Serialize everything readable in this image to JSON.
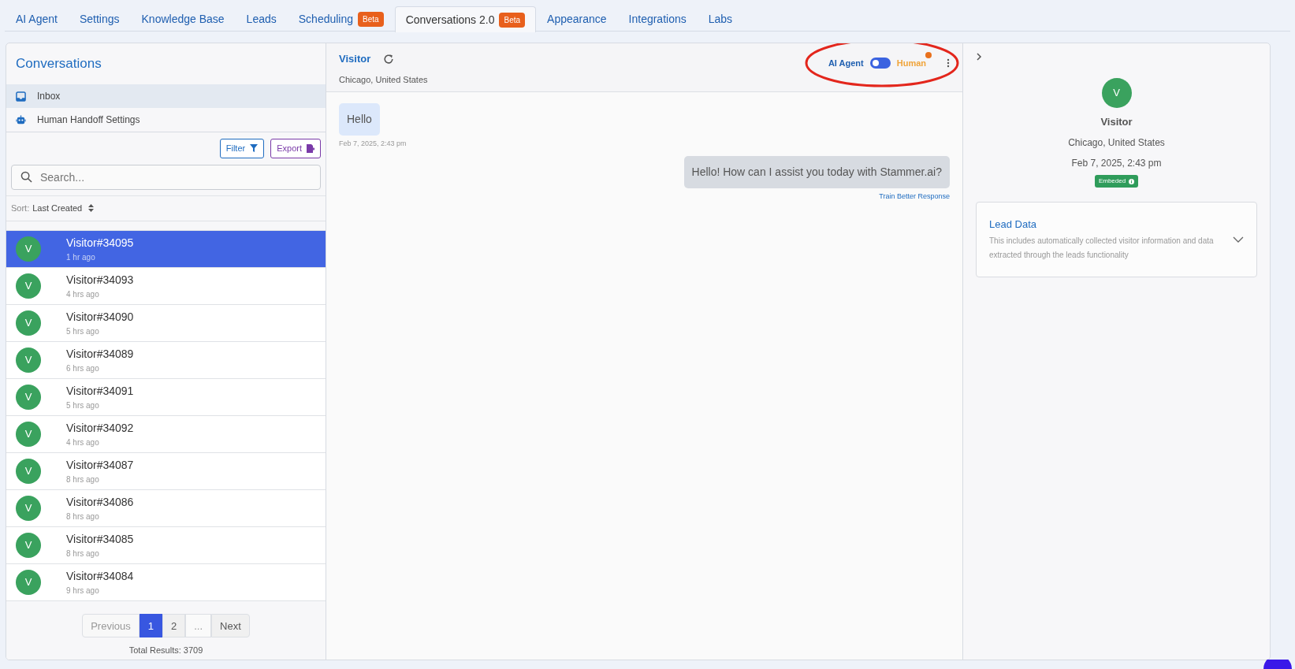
{
  "tabs": [
    {
      "label": "AI Agent",
      "selected": false
    },
    {
      "label": "Settings",
      "selected": false
    },
    {
      "label": "Knowledge Base",
      "selected": false
    },
    {
      "label": "Leads",
      "selected": false
    },
    {
      "label": "Scheduling",
      "badge": "Beta",
      "selected": false
    },
    {
      "label": "Conversations 2.0",
      "badge": "Beta",
      "selected": true
    },
    {
      "label": "Appearance",
      "selected": false
    },
    {
      "label": "Integrations",
      "selected": false
    },
    {
      "label": "Labs",
      "selected": false
    }
  ],
  "sidebar": {
    "title": "Conversations",
    "menu": [
      {
        "label": "Inbox",
        "kind": "inbox",
        "selected": true
      },
      {
        "label": "Human Handoff Settings",
        "kind": "robot",
        "selected": false
      }
    ],
    "filter_button": "Filter",
    "export_button": "Export",
    "search": {
      "placeholder": "Search..."
    },
    "sort": {
      "label": "Sort:",
      "value": "Last Created"
    },
    "conversations": [
      {
        "initial": "V",
        "name": "Visitor#34095",
        "time": "1 hr ago",
        "selected": true
      },
      {
        "initial": "V",
        "name": "Visitor#34093",
        "time": "4 hrs ago",
        "selected": false
      },
      {
        "initial": "V",
        "name": "Visitor#34090",
        "time": "5 hrs ago",
        "selected": false
      },
      {
        "initial": "V",
        "name": "Visitor#34089",
        "time": "6 hrs ago",
        "selected": false
      },
      {
        "initial": "V",
        "name": "Visitor#34091",
        "time": "5 hrs ago",
        "selected": false
      },
      {
        "initial": "V",
        "name": "Visitor#34092",
        "time": "4 hrs ago",
        "selected": false
      },
      {
        "initial": "V",
        "name": "Visitor#34087",
        "time": "8 hrs ago",
        "selected": false
      },
      {
        "initial": "V",
        "name": "Visitor#34086",
        "time": "8 hrs ago",
        "selected": false
      },
      {
        "initial": "V",
        "name": "Visitor#34085",
        "time": "8 hrs ago",
        "selected": false
      },
      {
        "initial": "V",
        "name": "Visitor#34084",
        "time": "9 hrs ago",
        "selected": false
      }
    ],
    "pagination": [
      {
        "label": "Previous",
        "kind": "prev",
        "selected": false
      },
      {
        "label": "1",
        "kind": "page",
        "selected": true
      },
      {
        "label": "2",
        "kind": "page",
        "selected": false
      },
      {
        "label": "...",
        "kind": "ellipsis",
        "selected": false
      },
      {
        "label": "Next",
        "kind": "next",
        "selected": false
      }
    ],
    "total": "Total Results: 3709"
  },
  "chat": {
    "title": "Visitor",
    "location": "Chicago, United States",
    "mode_left": "AI Agent",
    "mode_right": "Human",
    "mode_human": false,
    "messages": [
      {
        "kind": "visitor",
        "text": "Hello",
        "time": "Feb 7, 2025, 2:43 pm"
      },
      {
        "kind": "agent",
        "text": "Hello! How can I assist you today with Stammer.ai?",
        "action": "Train Better Response"
      }
    ]
  },
  "details": {
    "initial": "V",
    "name": "Visitor",
    "location": "Chicago, United States",
    "date": "Feb 7, 2025, 2:43 pm",
    "badge": "Embeded",
    "lead_data": {
      "title": "Lead Data",
      "description": "This includes automatically collected visitor information and data extracted through the leads functionality",
      "expanded": false
    }
  }
}
